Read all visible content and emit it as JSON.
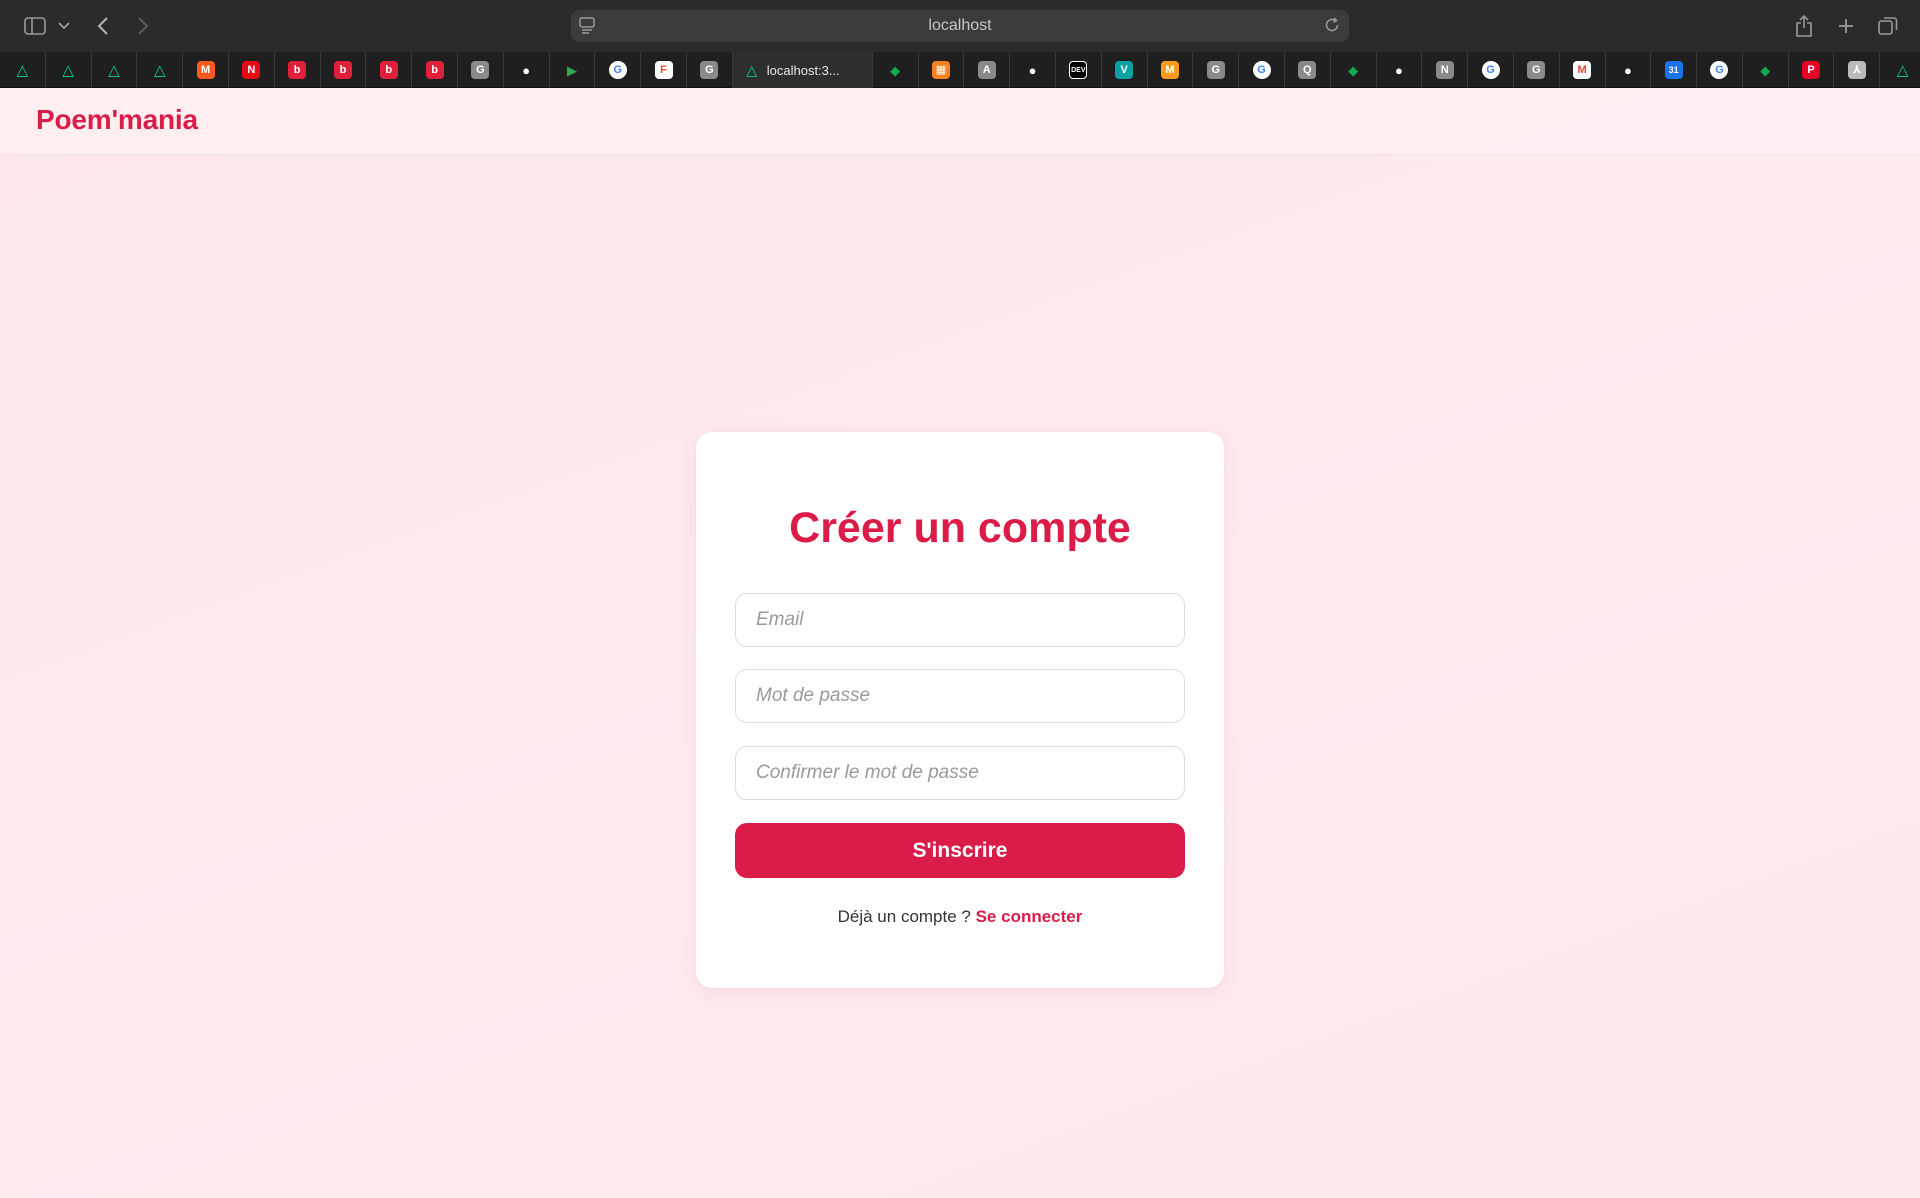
{
  "browser": {
    "address": "localhost",
    "active_tab_title": "localhost:3...",
    "tabs": [
      {
        "icon": "nuxt-icon",
        "color": "#00dc82"
      },
      {
        "icon": "nuxt-icon",
        "color": "#00dc82"
      },
      {
        "icon": "nuxt-icon",
        "color": "#00dc82"
      },
      {
        "icon": "nuxt-icon",
        "color": "#00dc82"
      },
      {
        "icon": "m-logo-icon",
        "color": "#ff5a1f"
      },
      {
        "icon": "netflix-icon",
        "color": "#e50914"
      },
      {
        "icon": "b-icon",
        "color": "#e0203a"
      },
      {
        "icon": "b-icon",
        "color": "#e0203a"
      },
      {
        "icon": "b-icon",
        "color": "#e0203a"
      },
      {
        "icon": "b-icon",
        "color": "#e0203a"
      },
      {
        "icon": "g-letter-icon",
        "color": "#8a8a8a"
      },
      {
        "icon": "github-icon",
        "color": "#ffffff"
      },
      {
        "icon": "meet-icon",
        "color": "#34a853"
      },
      {
        "icon": "google-icon",
        "color": "#4285f4"
      },
      {
        "icon": "figma-icon",
        "color": "#f24e1e"
      },
      {
        "icon": "g-letter-icon",
        "color": "#8a8a8a"
      },
      {
        "icon": "mongodb-icon",
        "color": "#13aa52"
      },
      {
        "icon": "orange-app-icon",
        "color": "#f58220"
      },
      {
        "icon": "a-letter-icon",
        "color": "#8a8a8a"
      },
      {
        "icon": "github-icon",
        "color": "#ffffff"
      },
      {
        "icon": "dev-icon",
        "color": "#ffffff"
      },
      {
        "icon": "v-icon",
        "color": "#0aa3a3"
      },
      {
        "icon": "m-logo-icon",
        "color": "#ff9a1f"
      },
      {
        "icon": "g-letter-icon",
        "color": "#8a8a8a"
      },
      {
        "icon": "google-icon",
        "color": "#4285f4"
      },
      {
        "icon": "q-letter-icon",
        "color": "#8a8a8a"
      },
      {
        "icon": "mongodb-icon",
        "color": "#13aa52"
      },
      {
        "icon": "github-icon",
        "color": "#ffffff"
      },
      {
        "icon": "n-letter-icon",
        "color": "#8a8a8a"
      },
      {
        "icon": "google-icon",
        "color": "#4285f4"
      },
      {
        "icon": "g-letter-icon",
        "color": "#8a8a8a"
      },
      {
        "icon": "gmail-icon",
        "color": "#ea4335"
      },
      {
        "icon": "github-icon",
        "color": "#ffffff"
      },
      {
        "icon": "calendar-icon",
        "color": "#1a73e8"
      },
      {
        "icon": "google-icon",
        "color": "#4285f4"
      },
      {
        "icon": "mongodb-icon",
        "color": "#13aa52"
      },
      {
        "icon": "pinterest-icon",
        "color": "#e60023"
      },
      {
        "icon": "acrobat-icon",
        "color": "#bbbbbb"
      },
      {
        "icon": "nuxt-icon",
        "color": "#00dc82"
      }
    ],
    "tab_letters": {
      "netflix-icon": "N",
      "b-icon": "b",
      "g-letter-icon": "G",
      "a-letter-icon": "A",
      "dev-icon": "DEV",
      "v-icon": "V",
      "q-letter-icon": "Q",
      "n-letter-icon": "N",
      "m-logo-icon": "M",
      "calendar-icon": "31",
      "google-icon": "G",
      "figma-icon": "F",
      "gmail-icon": "M",
      "pinterest-icon": "P",
      "orange-app-icon": "▦",
      "acrobat-icon": "⅄",
      "meet-icon": "▶",
      "mongodb-icon": "◆",
      "github-icon": "●",
      "nuxt-icon": "△"
    }
  },
  "app": {
    "brand": "Poem'mania",
    "accent_color": "#dc1c48"
  },
  "signup": {
    "title": "Créer un compte",
    "email_placeholder": "Email",
    "password_placeholder": "Mot de passe",
    "confirm_placeholder": "Confirmer le mot de passe",
    "submit_label": "S'inscrire",
    "login_prompt": "Déjà un compte ? ",
    "login_link": "Se connecter"
  }
}
